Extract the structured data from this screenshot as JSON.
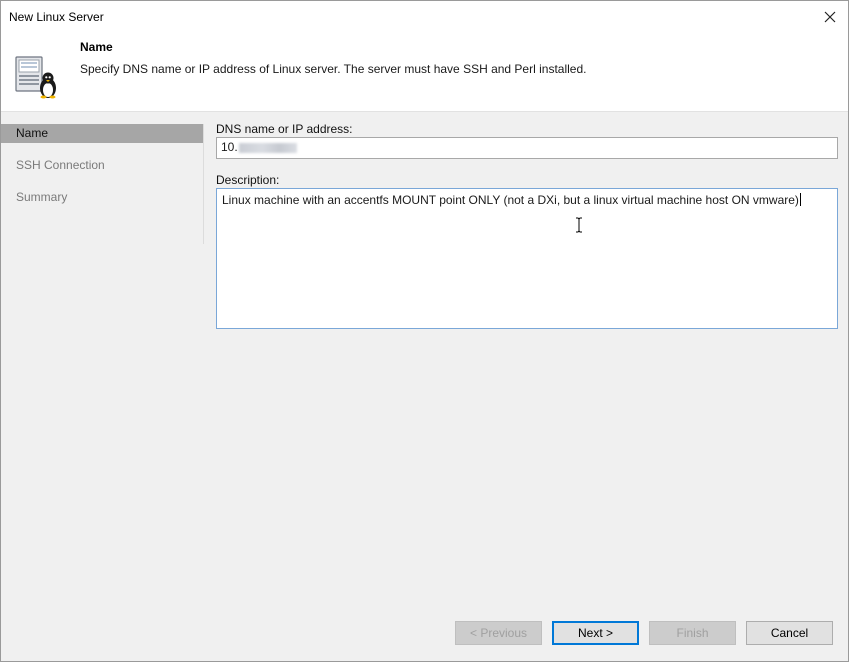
{
  "window": {
    "title": "New Linux Server"
  },
  "header": {
    "title": "Name",
    "description": "Specify DNS name or IP address of Linux server. The server must have SSH and Perl installed."
  },
  "steps": [
    {
      "label": "Name",
      "active": true
    },
    {
      "label": "SSH Connection",
      "active": false
    },
    {
      "label": "Summary",
      "active": false
    }
  ],
  "form": {
    "dns_label": "DNS name or IP address:",
    "dns_value": "10.",
    "description_label": "Description:",
    "description_value": "Linux machine with an accentfs MOUNT point ONLY (not a DXi, but a linux virtual machine  host ON vmware)"
  },
  "buttons": {
    "previous": "< Previous",
    "next": "Next >",
    "finish": "Finish",
    "cancel": "Cancel"
  },
  "icons": {
    "close": "close-icon",
    "server": "linux-server-icon",
    "text_cursor": "i-beam-cursor-icon"
  },
  "colors": {
    "active_step_bg": "#a6a6a6",
    "focus_border": "#7aa7d8",
    "default_button_border": "#0078d7"
  }
}
